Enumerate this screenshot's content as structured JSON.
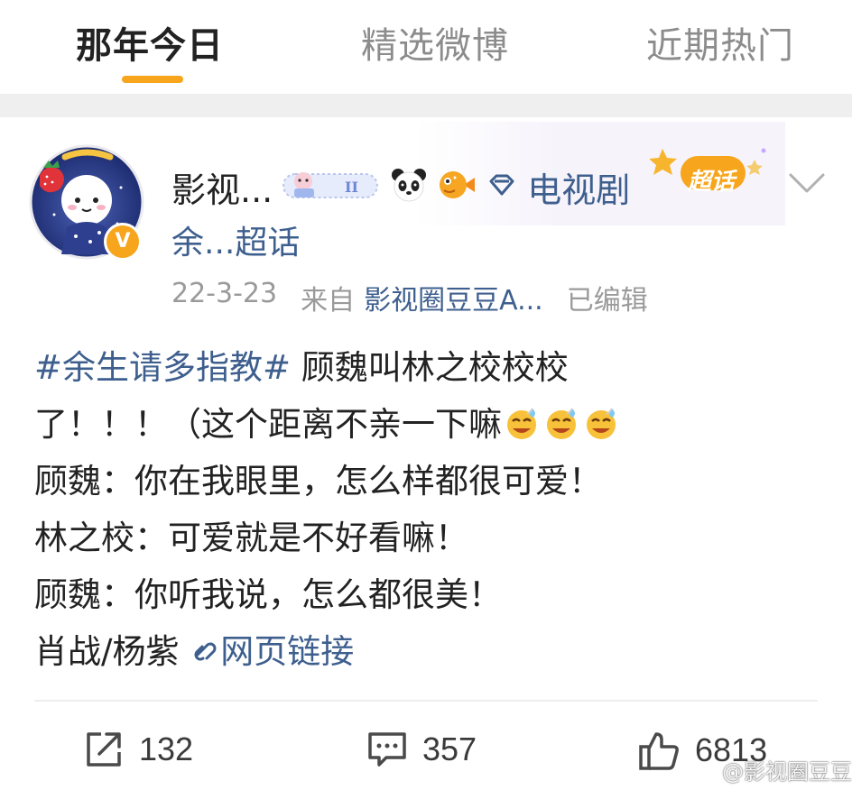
{
  "tabs": [
    {
      "label": "那年今日",
      "active": true
    },
    {
      "label": "精选微博",
      "active": false
    },
    {
      "label": "近期热门",
      "active": false
    }
  ],
  "accent_color": "#f7a51c",
  "link_color": "#3e5f8e",
  "post": {
    "author": {
      "name": "影视...",
      "verified_badge": "V",
      "badges": [
        "gemini-sticker-icon",
        "panda-icon",
        "pufferfish-icon"
      ],
      "category_icon": "diamond-icon",
      "category": "电视剧",
      "chaohua_tag": "超话",
      "subline": "余...超话"
    },
    "meta": {
      "date": "22-3-23",
      "source_label": "来自",
      "source_name": "影视圈豆豆A...",
      "edited": "已编辑"
    },
    "body": {
      "hashtag": "#余生请多指教#",
      "line1_rest": " 顾魏叫林之校校校",
      "line2": "了！！！（这个距离不亲一下嘛",
      "line3": "顾魏：你在我眼里，怎么样都很可爱！",
      "line4": "林之校：可爱就是不好看嘛！",
      "line5": "顾魏：你听我说，怎么都很美！",
      "line6_text": "肖战/杨紫 ",
      "link_icon": "link-icon",
      "link_text": "网页链接",
      "emoji": "happy-sweat-emoji"
    },
    "actions": {
      "repost_count": "132",
      "comment_count": "357",
      "like_count": "6813"
    }
  },
  "watermark": "@影视圈豆豆"
}
